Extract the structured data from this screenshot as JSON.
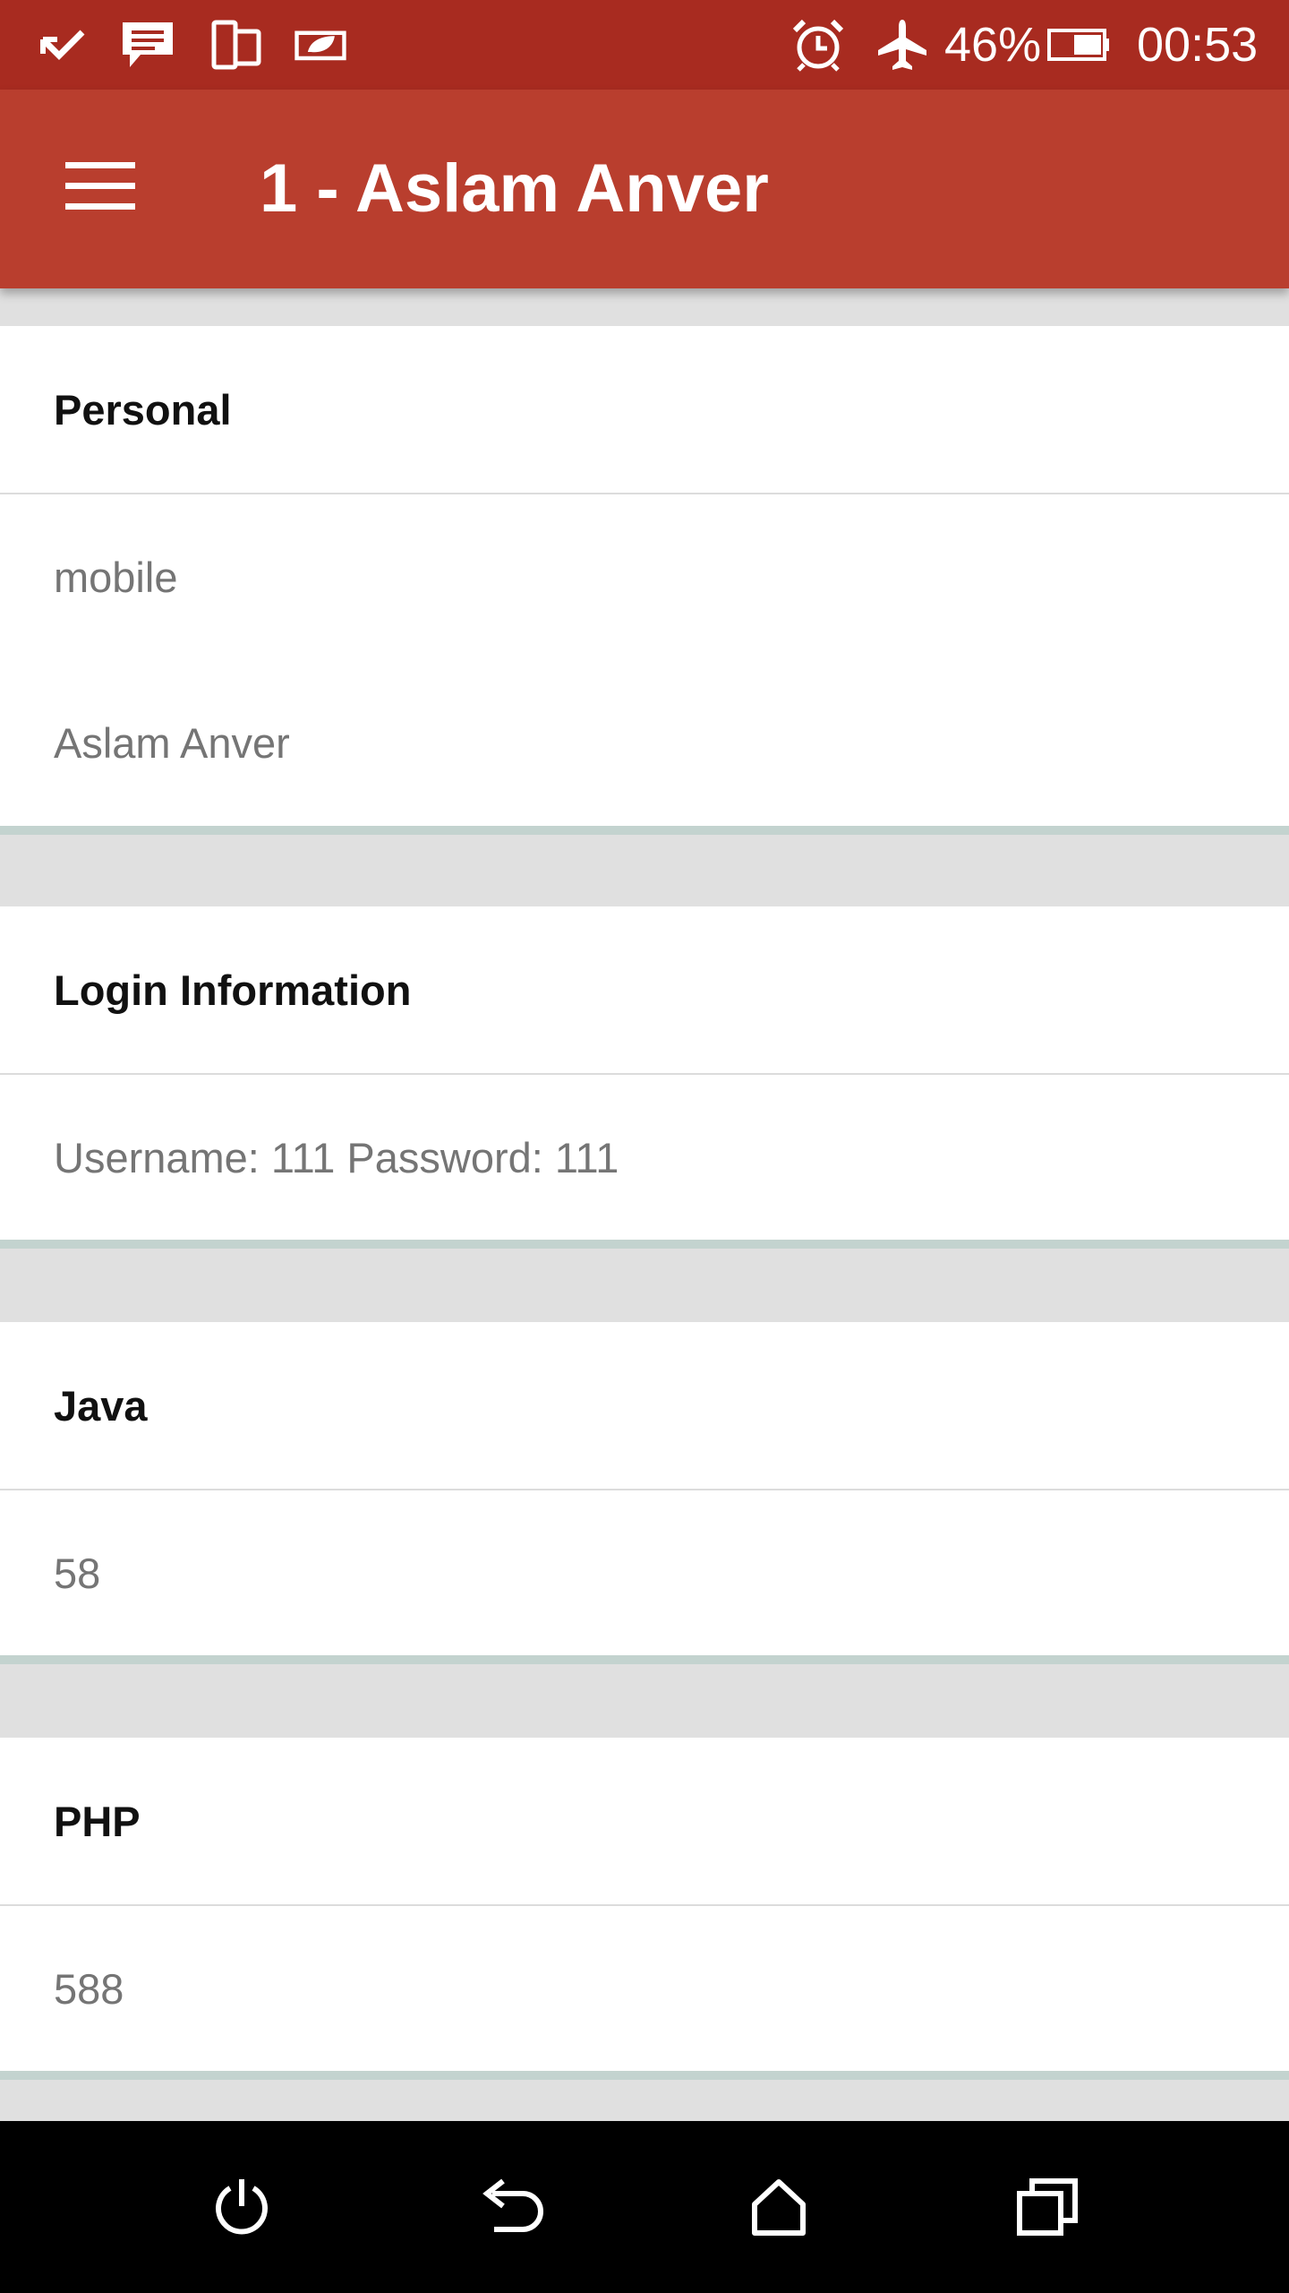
{
  "status_bar": {
    "icons": [
      "missed-call-icon",
      "message-icon",
      "phone-tablet-icon",
      "eco-icon",
      "alarm-icon",
      "airplane-icon",
      "battery-icon"
    ],
    "battery_percent": "46%",
    "time": "00:53"
  },
  "app_bar": {
    "menu_icon": "hamburger-menu-icon",
    "title": "1 - Aslam Anver"
  },
  "sections": {
    "personal": {
      "header": "Personal",
      "rows": [
        "mobile",
        "Aslam Anver"
      ]
    },
    "login": {
      "header": "Login Information",
      "rows": [
        "Username: 111 Password: 111"
      ]
    },
    "java": {
      "header": "Java",
      "rows": [
        "58"
      ]
    },
    "php": {
      "header": "PHP",
      "rows": [
        "588"
      ]
    }
  },
  "nav_bar": {
    "icons": [
      "power-icon",
      "back-icon",
      "home-icon",
      "recents-icon"
    ]
  },
  "colors": {
    "status_bar": "#a82b20",
    "app_bar": "#b93e2e",
    "divider_accent": "#c3d3cf",
    "background": "#e0e0e0"
  }
}
